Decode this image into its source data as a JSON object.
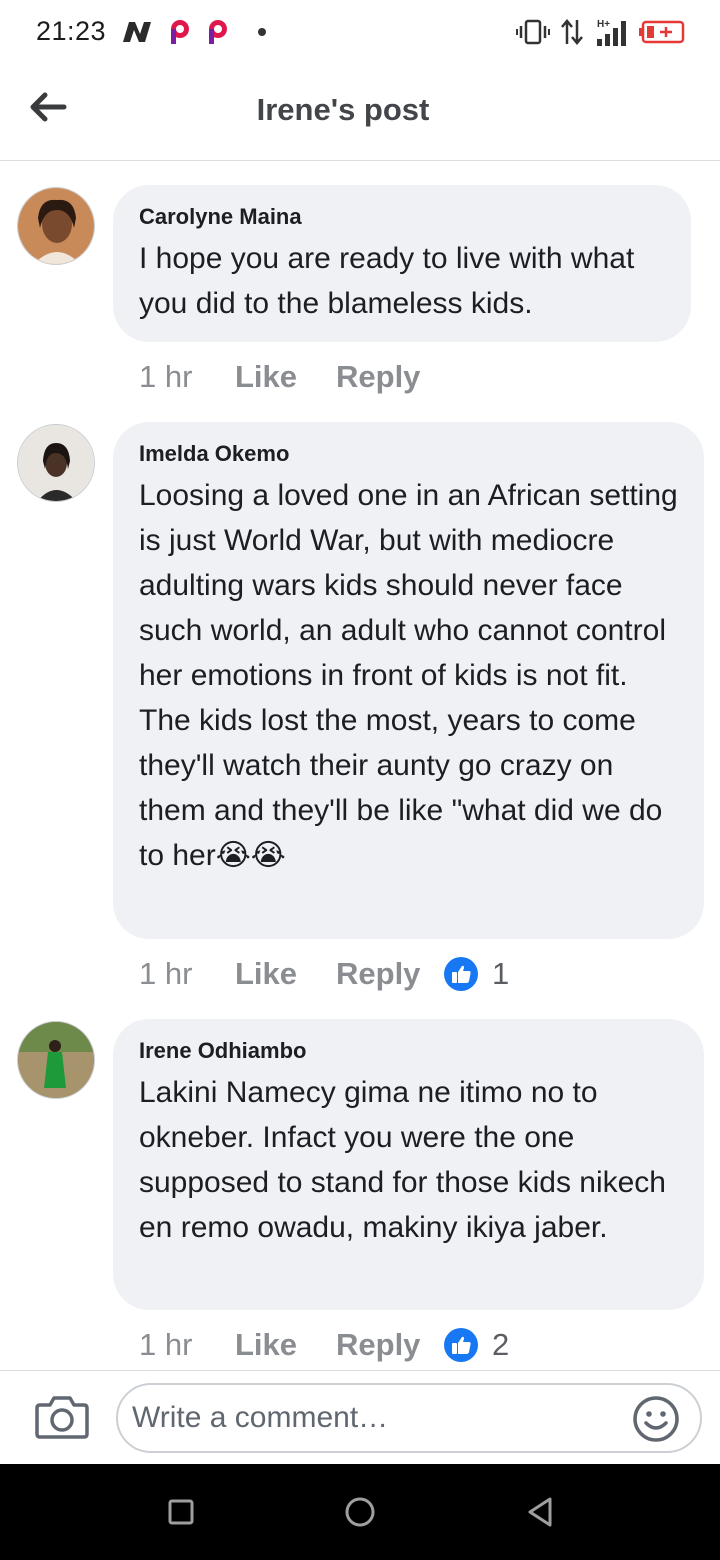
{
  "status_bar": {
    "time": "21:23",
    "icons": [
      "n-app-icon",
      "p-app-icon",
      "p-app-icon",
      "notification-dot-icon",
      "vibrate-icon",
      "data-arrows-icon",
      "signal-h-plus-icon",
      "battery-low-icon"
    ],
    "accent_colors": {
      "p_icon": "#e0174d",
      "battery": "#e53935"
    }
  },
  "header": {
    "title": "Irene's post",
    "back_icon": "arrow-left-icon"
  },
  "comments": [
    {
      "author": "Carolyne Maina",
      "text": "I hope you are ready to live with what you did to the blameless kids.",
      "time": "1 hr",
      "like_label": "Like",
      "reply_label": "Reply",
      "reaction_count": null
    },
    {
      "author": "Imelda Okemo",
      "text": "Loosing a loved one in an African setting is just World War, but with mediocre adulting wars kids should never face such world, an adult who cannot control her emotions in front of kids is not fit. The kids lost the most, years to come they'll watch their aunty go crazy on them and they'll be like \"what did we do to her😭😭",
      "time": "1 hr",
      "like_label": "Like",
      "reply_label": "Reply",
      "reaction_count": "1"
    },
    {
      "author": "Irene Odhiambo",
      "text": "Lakini Namecy gima ne itimo no to okneber. Infact you were the one supposed to stand for those kids nikech en remo owadu, makiny ikiya jaber.",
      "time": "1 hr",
      "like_label": "Like",
      "reply_label": "Reply",
      "reaction_count": "2"
    }
  ],
  "composer": {
    "placeholder": "Write a comment…",
    "camera_icon": "camera-icon",
    "emoji_icon": "smiley-icon"
  },
  "nav_bar": {
    "icons": [
      "square-recents-icon",
      "circle-home-icon",
      "triangle-back-icon"
    ]
  },
  "colors": {
    "bubble": "#eff1f4",
    "like_blue": "#1877f2",
    "muted_text": "#8a8d91"
  }
}
